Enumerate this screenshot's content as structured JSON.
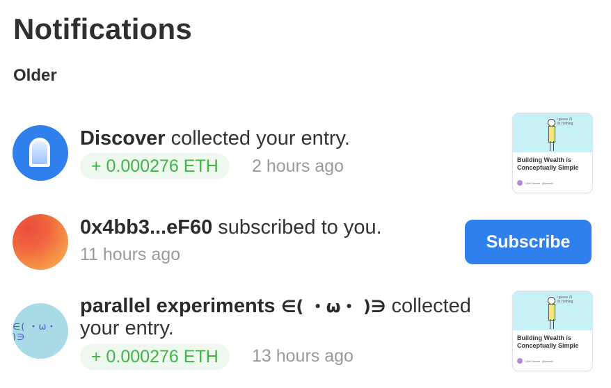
{
  "page": {
    "title": "Notifications",
    "section": "Older"
  },
  "notifications": [
    {
      "actor": "Discover",
      "action": " collected your entry.",
      "amount": "+ 0.000276 ETH",
      "time": "2 hours ago",
      "avatar_icon": "discover-shield-icon",
      "thumbnail": {
        "caption": "Building Wealth is Conceptually Simple",
        "bubble": "I guess I'll do nothing",
        "author": "Clint Conzet",
        "author_sub": "@conzet"
      }
    },
    {
      "actor": "0x4bb3...eF60",
      "action": " subscribed to you.",
      "time": "11 hours ago",
      "button": "Subscribe"
    },
    {
      "actor": "parallel experiments",
      "actor_suffix": " ∈( ・ω・ )∋",
      "action": " collected",
      "action2": "your entry.",
      "amount": "+ 0.000276 ETH",
      "time": "13 hours ago",
      "avatar_text": "∈( ・ω・ )∋",
      "thumbnail": {
        "caption": "Building Wealth is Conceptually Simple",
        "bubble": "I guess I'll do nothing",
        "author": "Clint Conzet",
        "author_sub": "@conzet"
      }
    }
  ],
  "colors": {
    "accent": "#2f80ed",
    "eth_text": "#41b349",
    "eth_bg": "#eef8ee",
    "muted": "#9a9a9a"
  }
}
